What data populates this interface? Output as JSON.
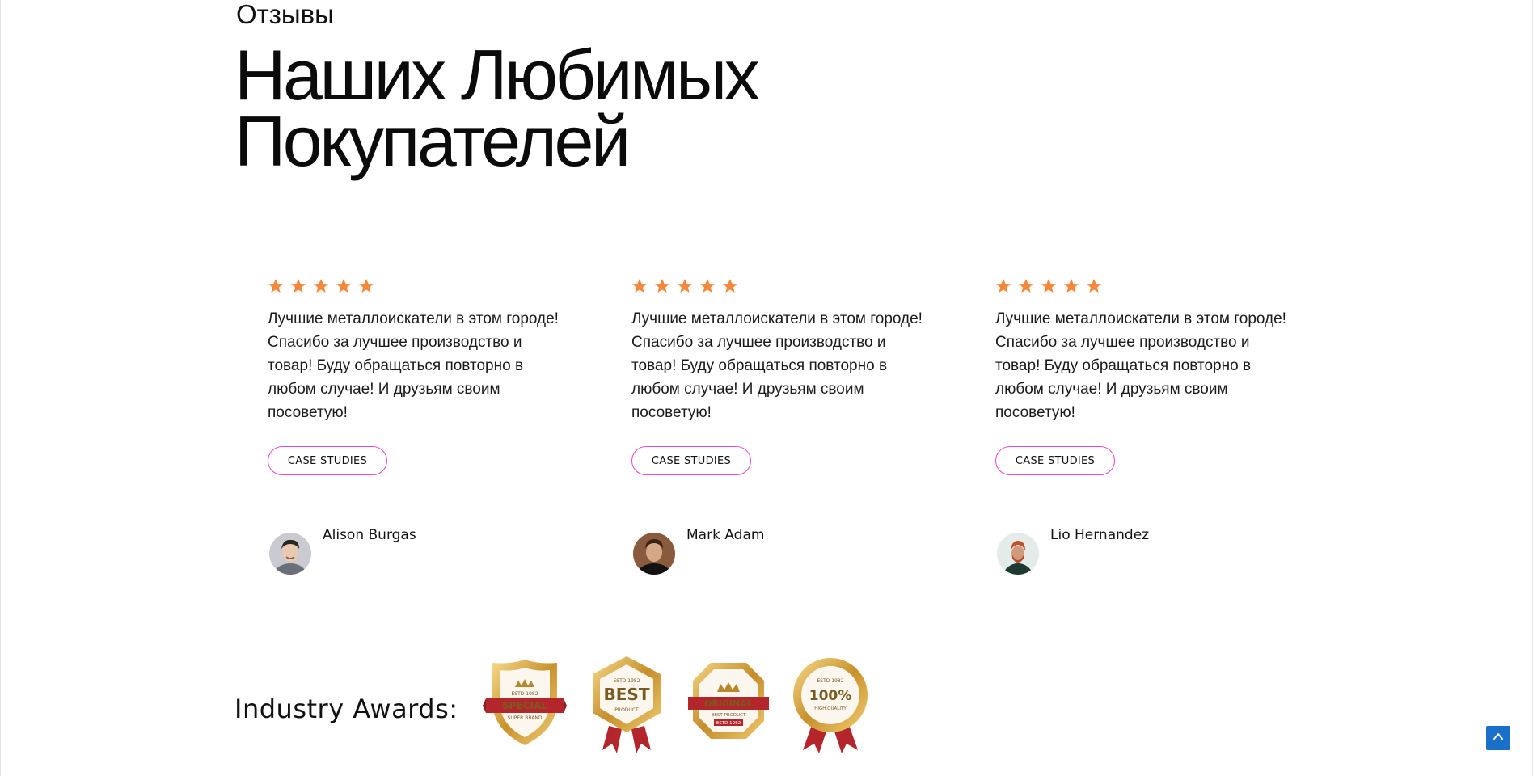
{
  "section": {
    "eyebrow": "Отзывы",
    "title_line1": "Наших Любимых",
    "title_line2": "Покупателей"
  },
  "testimonials": [
    {
      "rating": 5,
      "quote": "Лучшие металлоискатели в этом городе! Спасибо за лучшее производство и товар! Буду обращаться повторно в любом случае! И друзьям своим посоветую!",
      "button_label": "CASE STUDIES",
      "author": "Alison Burgas"
    },
    {
      "rating": 5,
      "quote": "Лучшие металлоискатели в этом городе! Спасибо за лучшее производство и товар! Буду обращаться повторно в любом случае! И друзьям своим посоветую!",
      "button_label": "CASE STUDIES",
      "author": "Mark Adam"
    },
    {
      "rating": 5,
      "quote": "Лучшие металлоискатели в этом городе! Спасибо за лучшее производство и товар! Буду обращаться повторно в любом случае! И друзьям своим посоветую!",
      "button_label": "CASE STUDIES",
      "author": "Lio Hernandez"
    }
  ],
  "awards": {
    "label": "Industry Awards:",
    "badges": [
      {
        "icon": "special-badge-icon",
        "top": "ESTD 1982",
        "main": "SPECIAL",
        "sub": "SUPER BRAND"
      },
      {
        "icon": "best-badge-icon",
        "top": "ESTD 1982",
        "main": "BEST",
        "sub": "PRODUCT"
      },
      {
        "icon": "original-badge-icon",
        "top": "",
        "main": "ORIGINAL",
        "sub": "BEST PRODUCT",
        "ribbon": "ESTD 1982"
      },
      {
        "icon": "quality-badge-icon",
        "top": "ESTD 1982",
        "main": "100%",
        "sub": "HIGH QUALITY"
      }
    ]
  },
  "colors": {
    "star": "#f5883a",
    "button_border": "#e946c9",
    "scroll_top_bg": "#1a6fc9",
    "gold": "#d9a43a",
    "ribbon_red": "#b3262c"
  },
  "icons": {
    "star": "star-icon",
    "scroll_top": "arrow-up-icon"
  }
}
